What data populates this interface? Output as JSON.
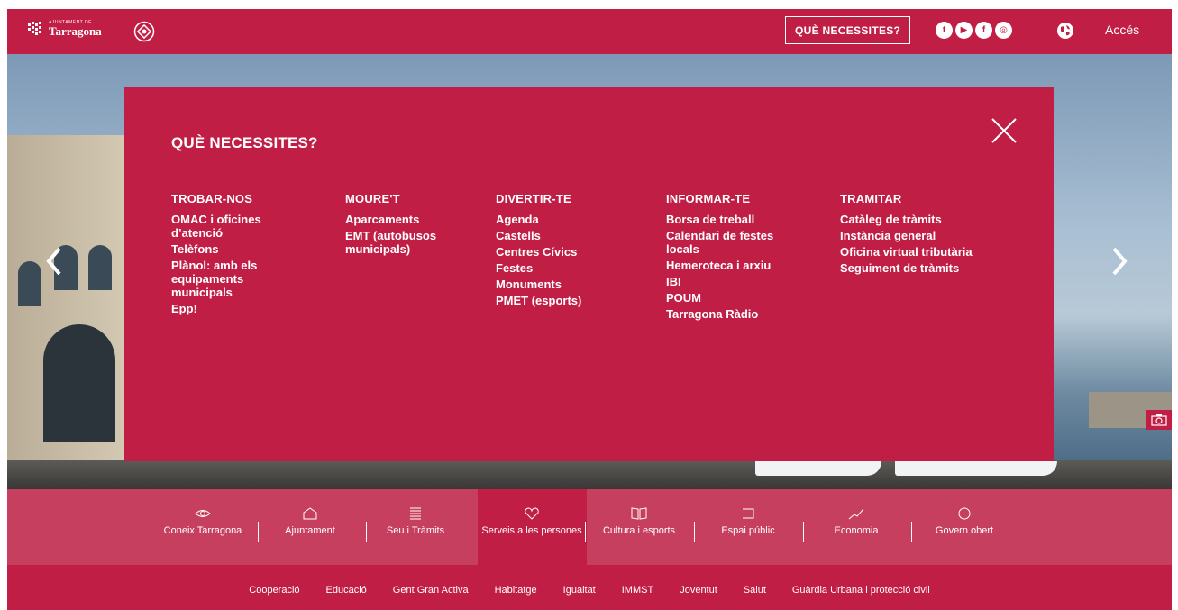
{
  "header": {
    "logo_small": "AJUNTAMENT DE",
    "logo_big": "Tarragona",
    "what_button": "QUÈ NECESSITES?",
    "socials": [
      {
        "icon": "twitter-icon",
        "glyph": "t"
      },
      {
        "icon": "youtube-icon",
        "glyph": "▶"
      },
      {
        "icon": "facebook-icon",
        "glyph": "f"
      },
      {
        "icon": "instagram-icon",
        "glyph": "◎"
      }
    ],
    "access_label": "Accés"
  },
  "overlay": {
    "title": "QUÈ NECESSITES?",
    "columns": [
      {
        "heading": "TROBAR-NOS",
        "links": [
          "OMAC i oficines d’atenció",
          "Telèfons",
          "Plànol: amb els equipaments municipals",
          "Epp!"
        ]
      },
      {
        "heading": "MOURE'T",
        "links": [
          "Aparcaments",
          "EMT (autobusos municipals)"
        ]
      },
      {
        "heading": "DIVERTIR-TE",
        "links": [
          "Agenda",
          "Castells",
          "Centres Cívics",
          "Festes",
          "Monuments",
          "PMET (esports)"
        ]
      },
      {
        "heading": "INFORMAR-TE",
        "links": [
          "Borsa de treball",
          "Calendari de festes locals",
          "Hemeroteca i arxiu",
          "IBI",
          "POUM",
          "Tarragona Ràdio"
        ]
      },
      {
        "heading": "TRAMITAR",
        "links": [
          "Catàleg de tràmits",
          "Instància general",
          "Oficina virtual tributària",
          "Seguiment de tràmits"
        ]
      }
    ]
  },
  "categories": [
    {
      "label": "Coneix Tarragona",
      "icon": "eye-icon"
    },
    {
      "label": "Ajuntament",
      "icon": "building-icon"
    },
    {
      "label": "Seu i Tràmits",
      "icon": "list-icon"
    },
    {
      "label": "Serveis a les persones",
      "icon": "heart-icon",
      "active": true
    },
    {
      "label": "Cultura i esports",
      "icon": "book-icon"
    },
    {
      "label": "Espai públic",
      "icon": "square-icon"
    },
    {
      "label": "Economia",
      "icon": "chart-line-icon"
    },
    {
      "label": "Govern obert",
      "icon": "circle-icon"
    }
  ],
  "subnav": [
    "Cooperació",
    "Educació",
    "Gent Gran Activa",
    "Habitatge",
    "Igualtat",
    "IMMST",
    "Joventut",
    "Salut",
    "Guàrdia Urbana i protecció civil"
  ],
  "colors": {
    "brand": "#c11e45",
    "text": "#ffffff"
  }
}
